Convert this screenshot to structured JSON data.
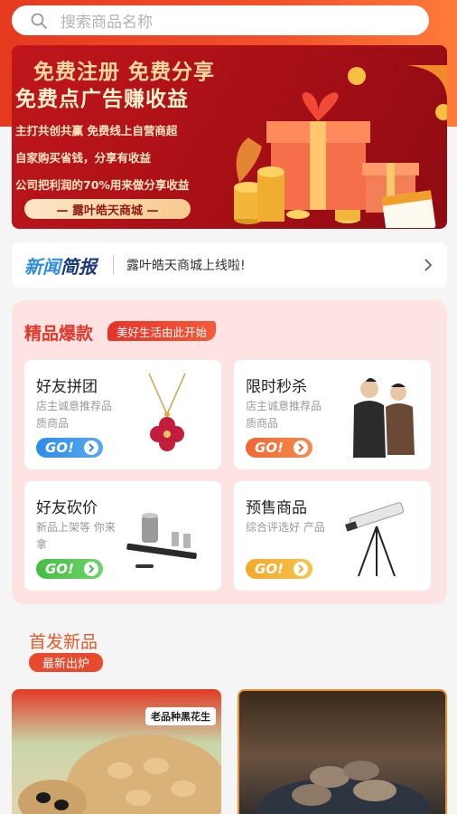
{
  "search": {
    "placeholder": "搜索商品名称",
    "icon": "search-icon"
  },
  "banner": {
    "line1": "免费注册 免费分享",
    "line2": "免费点广告赚收益",
    "points": [
      "主打共创共赢 免费线上自营商超",
      "自家购买省钱，分享有收益",
      "公司把利润的70%用来做分享收益"
    ],
    "brand": "— 露叶皓天商城 —"
  },
  "news": {
    "logo_a": "新闻",
    "logo_b": "简报",
    "text": "露叶皓天商城上线啦!"
  },
  "hot": {
    "title": "精品爆款",
    "tag": "美好生活由此开始",
    "cards": [
      {
        "name": "好友拼团",
        "desc": "店主诚意推荐品质商品",
        "go": "GO!",
        "color": "#2e8be8"
      },
      {
        "name": "限时秒杀",
        "desc": "店主诚意推荐品质商品",
        "go": "GO!",
        "color": "#f0672f"
      },
      {
        "name": "好友砍价",
        "desc": "新品上架等 你来拿",
        "go": "GO!",
        "color": "#4cc24a"
      },
      {
        "name": "预售商品",
        "desc": "综合评选好 产品",
        "go": "GO!",
        "color": "#f2b22a"
      }
    ]
  },
  "new_products": {
    "title": "首发新品",
    "tag": "最新出炉",
    "item1_label": "老品种黑花生"
  }
}
